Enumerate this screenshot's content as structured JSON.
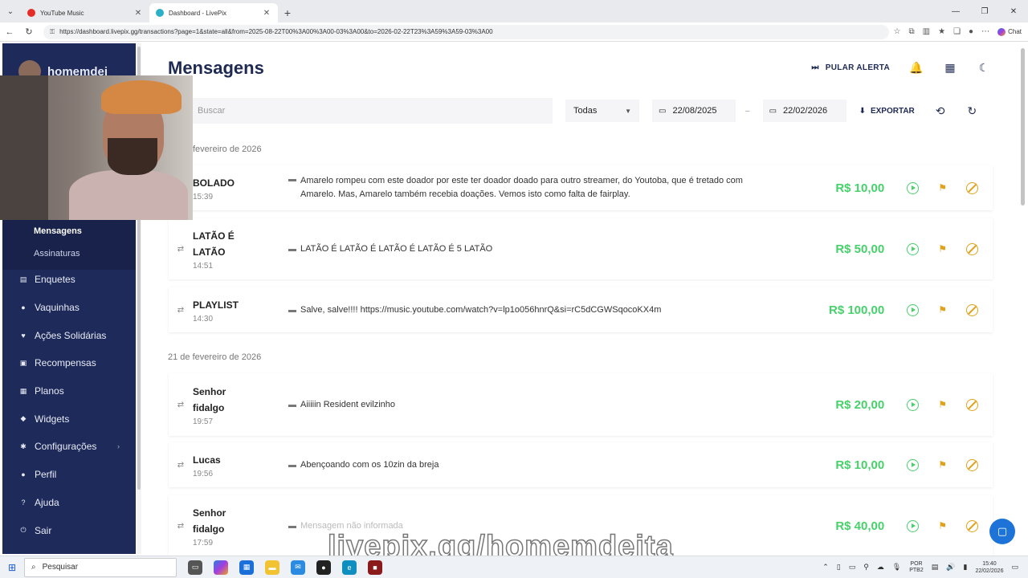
{
  "browser": {
    "tabs": [
      {
        "title": "YouTube Music",
        "favicon_color": "#e52d27"
      },
      {
        "title": "Dashboard - LivePix",
        "favicon_color": "#2bb0c8"
      }
    ],
    "url": "https://dashboard.livepix.gg/transactions?page=1&state=all&from=2025-08-22T00%3A00%3A00-03%3A00&to=2026-02-22T23%3A59%3A59-03%3A00",
    "chat_label": "Chat"
  },
  "sidebar": {
    "username": "homemdei",
    "sub_items": [
      {
        "label": "Mensagens",
        "active": true
      },
      {
        "label": "Assinaturas",
        "active": false
      }
    ],
    "items": [
      {
        "label": "Enquetes",
        "icon": "poll-icon",
        "glyph": "▤"
      },
      {
        "label": "Vaquinhas",
        "icon": "piggy-bank-icon",
        "glyph": "●"
      },
      {
        "label": "Ações Solidárias",
        "icon": "heart-hand-icon",
        "glyph": "♥"
      },
      {
        "label": "Recompensas",
        "icon": "gift-icon",
        "glyph": "▣"
      },
      {
        "label": "Planos",
        "icon": "plans-icon",
        "glyph": "▦"
      },
      {
        "label": "Widgets",
        "icon": "widgets-icon",
        "glyph": "◆"
      },
      {
        "label": "Configurações",
        "icon": "gear-icon",
        "glyph": "✱",
        "chevron": "›"
      },
      {
        "label": "Perfil",
        "icon": "user-icon",
        "glyph": "●"
      },
      {
        "label": "Ajuda",
        "icon": "help-icon",
        "glyph": "?"
      },
      {
        "label": "Sair",
        "icon": "logout-icon",
        "glyph": "⏻"
      }
    ]
  },
  "header": {
    "title": "Mensagens",
    "skip_alert_label": "PULAR ALERTA"
  },
  "filters": {
    "search_placeholder": "Buscar",
    "state_value": "Todas",
    "date_from": "22/08/2025",
    "date_sep": "–",
    "date_to": "22/02/2026",
    "export_label": "EXPORTAR"
  },
  "groups": [
    {
      "date": "fevereiro de 2026",
      "messages": [
        {
          "name": "BOLADO",
          "time": "15:39",
          "text": "Amarelo rompeu com este doador por este ter doador doado para outro streamer, do Youtoba, que é tretado com Amarelo. Mas, Amarelo também recebia doações. Vemos isto como falta de fairplay.",
          "amount": "R$ 10,00"
        },
        {
          "name": "LATÃO É LATÃO",
          "time": "14:51",
          "text": "LATÃO É LATÃO É LATÃO É LATÃO É 5 LATÃO",
          "amount": "R$ 50,00"
        },
        {
          "name": "PLAYLIST",
          "time": "14:30",
          "text": "Salve, salve!!!! https://music.youtube.com/watch?v=lp1o056hnrQ&si=rC5dCGWSqocoKX4m",
          "amount": "R$ 100,00"
        }
      ]
    },
    {
      "date": "21 de fevereiro de 2026",
      "messages": [
        {
          "name": "Senhor fidalgo",
          "time": "19:57",
          "text": "Aiiiiin Resident evilzinho",
          "amount": "R$ 20,00"
        },
        {
          "name": "Lucas",
          "time": "19:56",
          "text": "Abençoando com os 10zin da breja",
          "amount": "R$ 10,00"
        },
        {
          "name": "Senhor fidalgo",
          "time": "17:59",
          "text": "Mensagem não informada",
          "amount": "R$ 40,00",
          "muted": true
        }
      ]
    }
  ],
  "overlay": {
    "watermark": "livepix.gg/homemdeita"
  },
  "taskbar": {
    "search_label": "Pesquisar",
    "lang_top": "POR",
    "lang_bottom": "PTB2",
    "time": "15:40",
    "date": "22/02/2026"
  },
  "colors": {
    "sidebar_bg": "#1e2a5a",
    "amount_green": "#46d16a",
    "action_amber": "#e0a21b",
    "title_navy": "#1f2a52"
  }
}
